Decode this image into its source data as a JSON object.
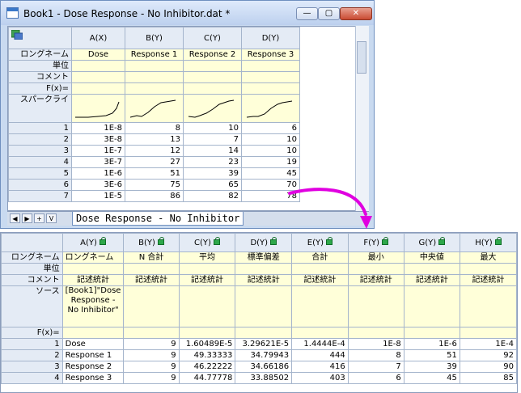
{
  "window": {
    "title": "Book1 - Dose Response - No Inhibitor.dat *",
    "minimize_label": "—",
    "maximize_label": "▢",
    "close_label": "✕"
  },
  "sheet1": {
    "columns": [
      "A(X)",
      "B(Y)",
      "C(Y)",
      "D(Y)"
    ],
    "row_headers": [
      "ロングネーム",
      "単位",
      "コメント",
      "F(x)=",
      "スパークライ"
    ],
    "long_names": [
      "Dose",
      "Response 1",
      "Response 2",
      "Response 3"
    ],
    "rows": [
      {
        "n": "1",
        "cells": [
          "1E-8",
          "8",
          "10",
          "6"
        ]
      },
      {
        "n": "2",
        "cells": [
          "3E-8",
          "13",
          "7",
          "10"
        ]
      },
      {
        "n": "3",
        "cells": [
          "1E-7",
          "12",
          "14",
          "10"
        ]
      },
      {
        "n": "4",
        "cells": [
          "3E-7",
          "27",
          "23",
          "19"
        ]
      },
      {
        "n": "5",
        "cells": [
          "1E-6",
          "51",
          "39",
          "45"
        ]
      },
      {
        "n": "6",
        "cells": [
          "3E-6",
          "75",
          "65",
          "70"
        ]
      },
      {
        "n": "7",
        "cells": [
          "1E-5",
          "86",
          "82",
          "78"
        ]
      }
    ],
    "tab_label": "Dose Response - No Inhibitor",
    "nav_buttons": [
      "◀",
      "▶",
      "+",
      "V"
    ]
  },
  "sheet2": {
    "columns": [
      "A(Y)",
      "B(Y)",
      "C(Y)",
      "D(Y)",
      "E(Y)",
      "F(Y)",
      "G(Y)",
      "H(Y)"
    ],
    "row_headers": [
      "ロングネーム",
      "単位",
      "コメント",
      "ソース",
      "F(x)="
    ],
    "long_names": [
      "ロングネーム",
      "N 合計",
      "平均",
      "標準偏差",
      "合計",
      "最小",
      "中央値",
      "最大"
    ],
    "comments": [
      "記述統計",
      "記述統計",
      "記述統計",
      "記述統計",
      "記述統計",
      "記述統計",
      "記述統計",
      "記述統計"
    ],
    "source": "[Book1]\"Dose Response - No Inhibitor\"",
    "rows": [
      {
        "n": "1",
        "cells": [
          "Dose",
          "9",
          "1.60489E-5",
          "3.29621E-5",
          "1.4444E-4",
          "1E-8",
          "1E-6",
          "1E-4"
        ]
      },
      {
        "n": "2",
        "cells": [
          "Response 1",
          "9",
          "49.33333",
          "34.79943",
          "444",
          "8",
          "51",
          "92"
        ]
      },
      {
        "n": "3",
        "cells": [
          "Response 2",
          "9",
          "46.22222",
          "34.66186",
          "416",
          "7",
          "39",
          "90"
        ]
      },
      {
        "n": "4",
        "cells": [
          "Response 3",
          "9",
          "44.77778",
          "33.88502",
          "403",
          "6",
          "45",
          "85"
        ]
      }
    ]
  },
  "colors": {
    "arrow": "#e000e0",
    "yellow_cell": "#ffffd9",
    "header": "#e4ebf5"
  }
}
